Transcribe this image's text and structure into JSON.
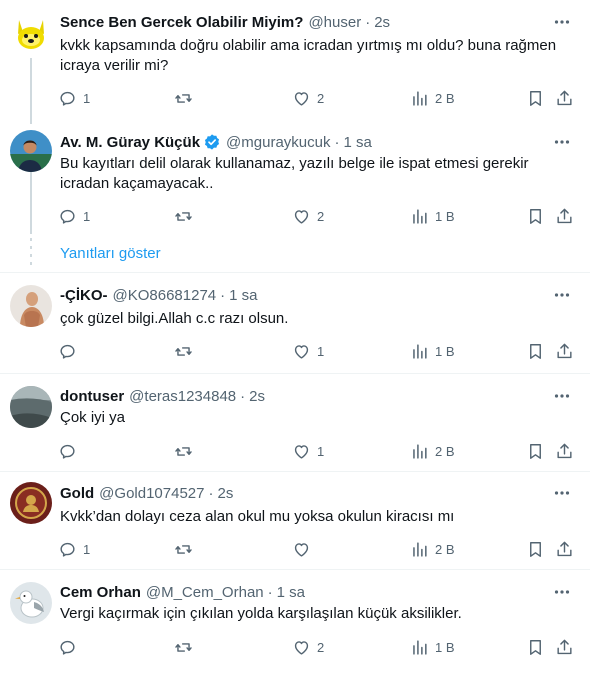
{
  "tweets": [
    {
      "name": "Sence Ben Gercek Olabilir Miyim?",
      "handle": "@huser",
      "time": "2s",
      "text": "kvkk kapsamında doğru olabilir ama icradan yırtmış mı oldu? buna rağmen icraya verilir mi?",
      "replies": "1",
      "retweets": "",
      "likes": "2",
      "views": "2 B",
      "avatar_icon": "doge-avatar-icon"
    },
    {
      "name": "Av. M. Güray Küçük",
      "handle": "@mguraykucuk",
      "time": "1 sa",
      "verified": true,
      "text": "Bu kayıtları delil olarak kullanamaz, yazılı belge ile ispat etmesi gerekir icradan kaçamayacak..",
      "replies": "1",
      "retweets": "",
      "likes": "2",
      "views": "1 B",
      "avatar_icon": "profile-photo-avatar-icon"
    },
    {
      "name": "-ÇİKO-",
      "handle": "@KO86681274",
      "time": "1 sa",
      "text": "çok güzel bilgi.Allah c.c razı olsun.",
      "replies": "",
      "retweets": "",
      "likes": "1",
      "views": "1 B",
      "avatar_icon": "photo-avatar-icon"
    },
    {
      "name": "dontuser",
      "handle": "@teras1234848",
      "time": "2s",
      "text": "Çok iyi ya",
      "replies": "",
      "retweets": "",
      "likes": "1",
      "views": "2 B",
      "avatar_icon": "landscape-avatar-icon"
    },
    {
      "name": "Gold",
      "handle": "@Gold1074527",
      "time": "2s",
      "text": "Kvkk’dan dolayı ceza alan okul mu yoksa okulun kiracısı mı",
      "replies": "1",
      "retweets": "",
      "likes": "",
      "views": "2 B",
      "avatar_icon": "emblem-avatar-icon"
    },
    {
      "name": "Cem Orhan",
      "handle": "@M_Cem_Orhan",
      "time": "1 sa",
      "text": "Vergi kaçırmak için çıkılan yolda karşılaşılan küçük aksilikler.",
      "replies": "",
      "retweets": "",
      "likes": "2",
      "views": "1 B",
      "avatar_icon": "bird-avatar-icon"
    }
  ],
  "show_replies_label": "Yanıtları göster",
  "separator": "·",
  "colors": {
    "text": "#0f1419",
    "secondary": "#536471",
    "link": "#1d9bf0",
    "border": "#eff3f4",
    "verified": "#1d9bf0"
  }
}
